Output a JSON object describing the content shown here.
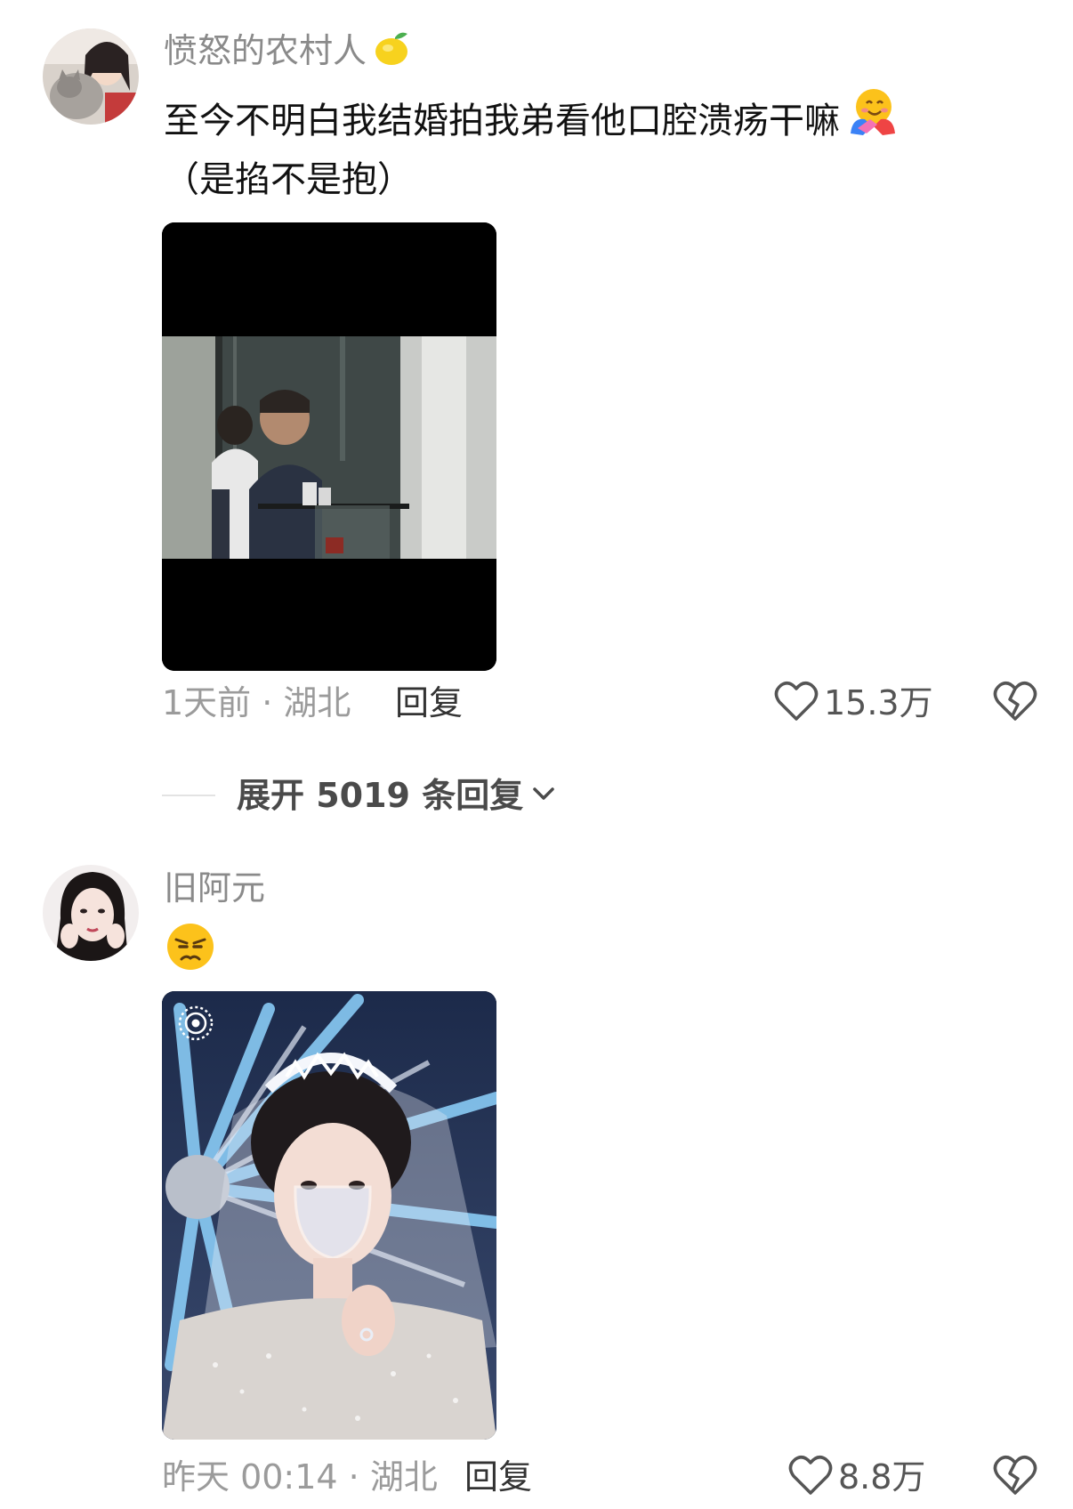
{
  "comments": [
    {
      "username": "愤怒的农村人",
      "username_badge": "lemon-icon",
      "text_line1": "至今不明白我结婚拍我弟看他口腔溃疡干嘛",
      "text_emoji": "hugging-face-icon",
      "text_line2": "（是掐不是抱）",
      "image": "video-thumbnail-bathroom-mirror",
      "time": "1天前 · 湖北",
      "reply_label": "回复",
      "likes": "15.3万"
    },
    {
      "username": "旧阿元",
      "text_emoji": "annoyed-face-icon",
      "image": "bride-holding-wine-glass",
      "time": "昨天 00:14 · 湖北",
      "reply_label": "回复",
      "likes": "8.8万"
    }
  ],
  "expand_replies": {
    "label": "展开 5019 条回复"
  }
}
